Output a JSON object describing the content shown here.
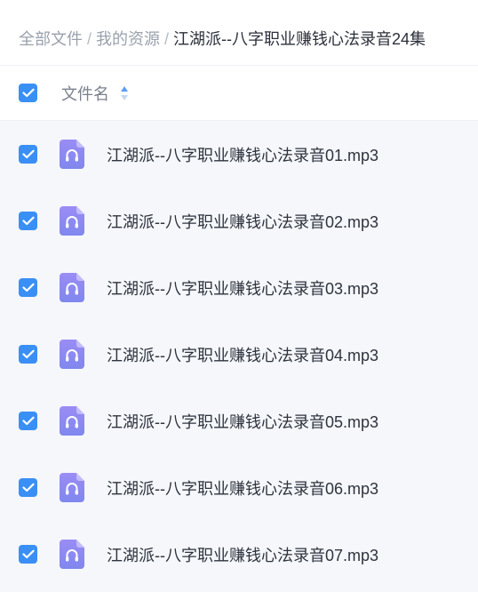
{
  "breadcrumb": {
    "items": [
      "全部文件",
      "我的资源"
    ],
    "separator": "/",
    "current": "江湖派--八字职业赚钱心法录音24集"
  },
  "table": {
    "header": {
      "name_label": "文件名",
      "select_all_checked": true
    },
    "rows": [
      {
        "name": "江湖派--八字职业赚钱心法录音01.mp3",
        "checked": true,
        "icon": "audio-file-icon"
      },
      {
        "name": "江湖派--八字职业赚钱心法录音02.mp3",
        "checked": true,
        "icon": "audio-file-icon"
      },
      {
        "name": "江湖派--八字职业赚钱心法录音03.mp3",
        "checked": true,
        "icon": "audio-file-icon"
      },
      {
        "name": "江湖派--八字职业赚钱心法录音04.mp3",
        "checked": true,
        "icon": "audio-file-icon"
      },
      {
        "name": "江湖派--八字职业赚钱心法录音05.mp3",
        "checked": true,
        "icon": "audio-file-icon"
      },
      {
        "name": "江湖派--八字职业赚钱心法录音06.mp3",
        "checked": true,
        "icon": "audio-file-icon"
      },
      {
        "name": "江湖派--八字职业赚钱心法录音07.mp3",
        "checked": true,
        "icon": "audio-file-icon"
      }
    ]
  },
  "colors": {
    "accent": "#3a8ff5",
    "audio_icon_top": "#9b8cf5",
    "audio_icon_bottom": "#7f87ee",
    "list_background": "#f5f7fb"
  }
}
